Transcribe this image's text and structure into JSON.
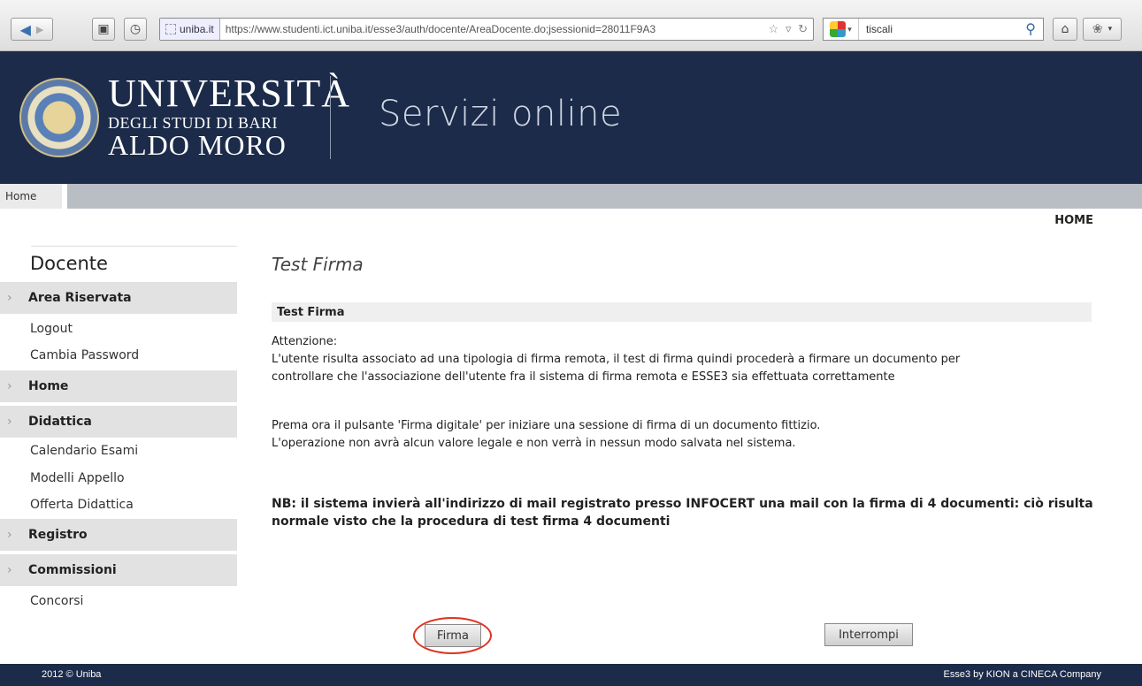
{
  "browser": {
    "url_site": "uniba.it",
    "url": "https://www.studenti.ict.uniba.it/esse3/auth/docente/AreaDocente.do;jsessionid=28011F9A3",
    "search_value": "tiscali",
    "icons": [
      "back-icon",
      "forward-icon",
      "bookmark-icon",
      "history-icon",
      "star-icon",
      "reload-icon",
      "search-icon",
      "home-icon",
      "addon-icon"
    ]
  },
  "header": {
    "logo_line1": "UNIVERSITÀ",
    "logo_line2": "DEGLI STUDI DI BARI",
    "logo_line3": "ALDO MORO",
    "title": "Servizi online"
  },
  "nav": {
    "home": "Home",
    "right_home": "HOME"
  },
  "sidebar": {
    "title": "Docente",
    "sections": [
      {
        "label": "Area Riservata"
      },
      {
        "label": "Home"
      },
      {
        "label": "Didattica"
      },
      {
        "label": "Registro"
      },
      {
        "label": "Commissioni"
      }
    ],
    "links": {
      "logout": "Logout",
      "cambia_password": "Cambia Password",
      "calendario_esami": "Calendario Esami",
      "modelli_appello": "Modelli Appello",
      "offerta_didattica": "Offerta Didattica",
      "concorsi": "Concorsi"
    }
  },
  "main": {
    "title": "Test Firma",
    "box_heading": "Test Firma",
    "attention": "Attenzione:",
    "para1_line1": "L'utente risulta associato ad una tipologia di firma remota, il test di firma quindi procederà a firmare un documento per",
    "para1_line2": "controllare che l'associazione dell'utente fra il sistema di firma remota e ESSE3 sia effettuata correttamente",
    "para2_line1": "Prema ora il pulsante 'Firma digitale' per iniziare una sessione di firma di un documento fittizio.",
    "para2_line2": "L'operazione non avrà alcun valore legale e non verrà in nessun modo salvata nel sistema.",
    "nb_line1": "NB: il sistema invierà all'indirizzo di mail registrato presso INFOCERT una mail con la firma di 4 documenti: ciò risulta",
    "nb_line2": "normale visto che la procedura di test firma 4 documenti",
    "firma_button": "Firma",
    "interrompi_button": "Interrompi"
  },
  "footer": {
    "left": "2012 © Uniba",
    "right": "Esse3 by KION a CINECA Company"
  }
}
